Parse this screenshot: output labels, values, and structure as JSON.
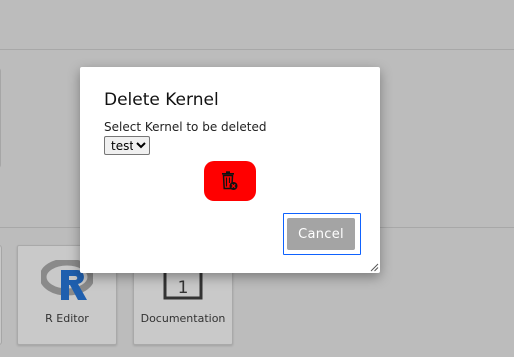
{
  "dialog": {
    "title": "Delete Kernel",
    "select_label": "Select Kernel to be deleted",
    "kernel_select": {
      "selected": "test",
      "options": [
        "test"
      ]
    },
    "delete_icon": "trash-delete-icon",
    "cancel_label": "Cancel"
  },
  "launcher": {
    "cards": [
      {
        "label": "R Editor",
        "icon": "r-logo-icon"
      },
      {
        "label": "Documentation",
        "icon": "documentation-icon",
        "icon_text": "1"
      }
    ]
  },
  "colors": {
    "delete_button": "#ff0000",
    "cancel_button": "#a4a4a4",
    "focus_ring": "#0f62fe",
    "r_logo_blue": "#1f5fae",
    "r_logo_gray": "#8a8a8a"
  }
}
